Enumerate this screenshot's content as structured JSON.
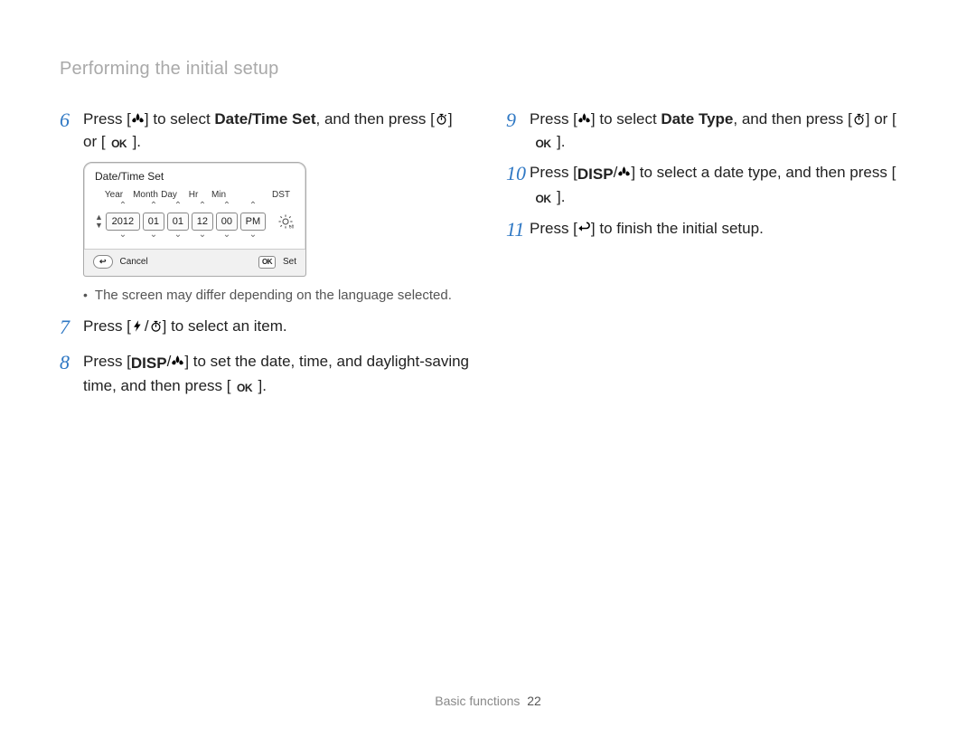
{
  "header": {
    "title": "Performing the initial setup"
  },
  "left": {
    "step6": {
      "num": "6",
      "p1": "Press [",
      "p2": "] to select ",
      "bold": "Date/Time Set",
      "p3": ", and then press [",
      "p4": "] or [",
      "ok": "OK",
      "p5": "]."
    },
    "lcd": {
      "title": "Date/Time Set",
      "labels": {
        "year": "Year",
        "month": "Month",
        "day": "Day",
        "hr": "Hr",
        "min": "Min",
        "dst": "DST"
      },
      "values": {
        "year": "2012",
        "month": "01",
        "day": "01",
        "hr": "12",
        "min": "00",
        "pm": "PM"
      },
      "footer": {
        "cancel": "Cancel",
        "ok": "OK",
        "set": "Set"
      }
    },
    "note": {
      "text": "The screen may differ depending on the language selected."
    },
    "step7": {
      "num": "7",
      "p1": "Press [",
      "p2": "/",
      "p3": "] to select an item."
    },
    "step8": {
      "num": "8",
      "p1": "Press [",
      "disp": "DISP",
      "p2": "/",
      "p3": "] to set the date, time, and daylight-saving time, and then press [",
      "ok": "OK",
      "p4": "]."
    }
  },
  "right": {
    "step9": {
      "num": "9",
      "p1": "Press [",
      "p2": "] to select ",
      "bold": "Date Type",
      "p3": ", and then press [",
      "p4": "] or [",
      "ok": "OK",
      "p5": "]."
    },
    "step10": {
      "num": "10",
      "p1": "Press [",
      "disp": "DISP",
      "p2": "/",
      "p3": "] to select a date type, and then press [",
      "ok": "OK",
      "p4": "]."
    },
    "step11": {
      "num": "11",
      "p1": "Press [",
      "p2": "] to finish the initial setup."
    }
  },
  "footer": {
    "section": "Basic functions",
    "page": "22"
  }
}
